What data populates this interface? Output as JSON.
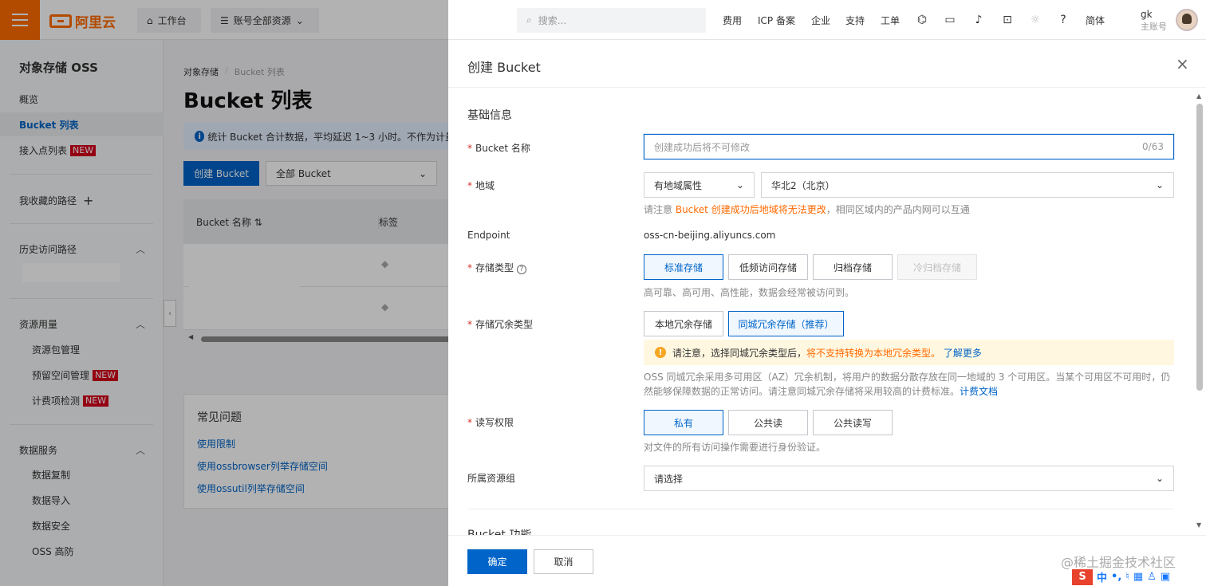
{
  "topbar": {
    "logo_text": "阿里云",
    "workbench": "工作台",
    "resources": "账号全部资源",
    "search_placeholder": "搜索...",
    "links": [
      "费用",
      "ICP 备案",
      "企业",
      "支持",
      "工单"
    ],
    "lang": "简体",
    "user_name": "gk",
    "user_role": "主账号",
    "brand_color": "#ff6a00"
  },
  "sidebar": {
    "title": "对象存储 OSS",
    "overview": "概览",
    "bucket_list": "Bucket 列表",
    "access_points": "接入点列表",
    "new_badge": "NEW",
    "favorites": "我收藏的路径",
    "history": "历史访问路径",
    "usage": "资源用量",
    "packages": "资源包管理",
    "reserved": "预留空间管理",
    "billing_check": "计费项检测",
    "data_services": "数据服务",
    "replication": "数据复制",
    "import": "数据导入",
    "security": "数据安全",
    "ddos": "OSS 高防"
  },
  "main": {
    "breadcrumb": [
      "对象存储",
      "Bucket 列表"
    ],
    "title": "Bucket 列表",
    "info": "统计 Bucket 合计数据，平均延迟 1~3 小时。不作为计量",
    "create_button": "创建 Bucket",
    "filter": "全部 Bucket",
    "col_name": "Bucket 名称",
    "col_tag": "标签",
    "faq_title": "常见问题",
    "faq_links": [
      "使用限制",
      "使用ossbrowser列举存储空间",
      "使用ossutil列举存储空间"
    ]
  },
  "drawer": {
    "title": "创建 Bucket",
    "section_basic": "基础信息",
    "name_label": "Bucket 名称",
    "name_placeholder": "创建成功后将不可修改",
    "name_count": "0/63",
    "region_label": "地域",
    "region_type": "有地域属性",
    "region_value": "华北2（北京）",
    "region_hint_pre": "请注意",
    "region_hint_warn": "Bucket 创建成功后地域将无法更改",
    "region_hint_post": "，相同区域内的产品内网可以互通",
    "endpoint_label": "Endpoint",
    "endpoint_value": "oss-cn-beijing.aliyuncs.com",
    "storage_label": "存储类型",
    "storage_options": [
      "标准存储",
      "低频访问存储",
      "归档存储",
      "冷归档存储"
    ],
    "storage_hint": "高可靠、高可用、高性能，数据会经常被访问到。",
    "redundancy_label": "存储冗余类型",
    "redundancy_options": [
      "本地冗余存储",
      "同城冗余存储（推荐）"
    ],
    "alert_pre": "请注意，选择同城冗余类型后，",
    "alert_warn": "将不支持转换为本地冗余类型。",
    "alert_link": "了解更多",
    "redundancy_desc": "OSS 同城冗余采用多可用区（AZ）冗余机制，将用户的数据分散存放在同一地域的 3 个可用区。当某个可用区不可用时，仍然能够保障数据的正常访问。请注意同城冗余存储将采用较高的计费标准。",
    "redundancy_link": "计费文档",
    "acl_label": "读写权限",
    "acl_options": [
      "私有",
      "公共读",
      "公共读写"
    ],
    "acl_hint": "对文件的所有访问操作需要进行身份验证。",
    "rg_label": "所属资源组",
    "rg_placeholder": "请选择",
    "next_section": "Bucket 功能",
    "ok": "确定",
    "cancel": "取消",
    "accent_color": "#0064c8"
  },
  "watermark": "@稀土掘金技术社区",
  "ime": {
    "logo": "S",
    "mode": "中"
  }
}
